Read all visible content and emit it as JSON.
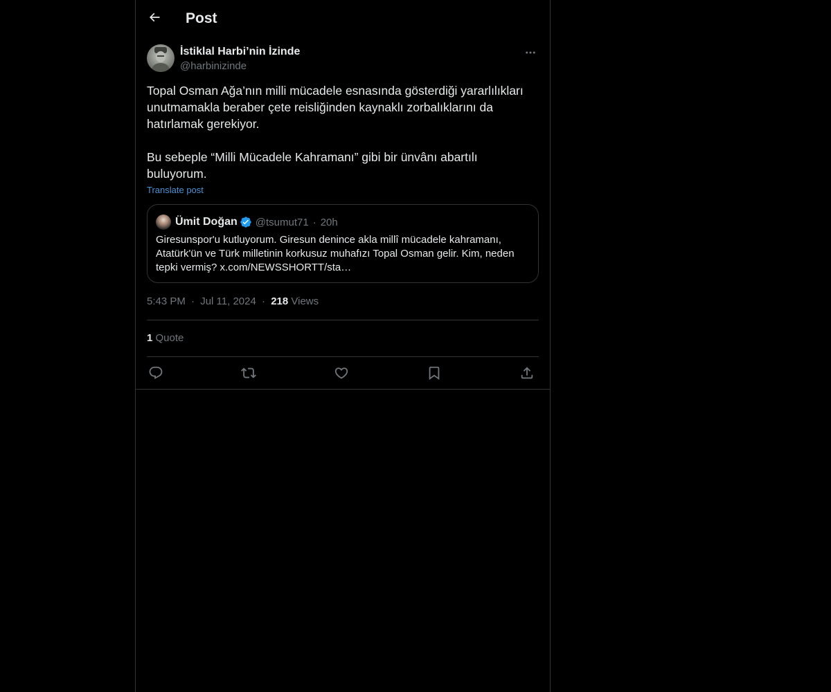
{
  "header": {
    "title": "Post",
    "back_icon": "arrow-left-icon"
  },
  "post": {
    "author_name": "İstiklal Harbi’nin İzinde",
    "author_handle": "@harbinizinde",
    "paragraph_1": "Topal Osman Ağa’nın milli mücadele esnasında gösterdiği yararlılıkları unutmamakla beraber çete reisliğinden kaynaklı zorbalıklarını da hatırlamak gerekiyor.",
    "paragraph_2": "Bu sebeple “Milli Mücadele Kahramanı” gibi bir ünvânı abartılı buluyorum.",
    "translate_label": "Translate post",
    "time": "5:43 PM",
    "separator": "·",
    "date": "Jul 11, 2024",
    "views_count": "218",
    "views_label": "Views",
    "quotes_count": "1",
    "quotes_label": "Quote"
  },
  "quoted_post": {
    "author_name": "Ümit Doğan",
    "author_handle": "@tsumut71",
    "separator": "·",
    "age": "20h",
    "text": "Giresunspor'u kutluyorum. Giresun denince akla millî mücadele kahramanı, Atatürk'ün ve Türk milletinin korkusuz muhafızı Topal Osman gelir. Kim, neden tepki vermiş? x.com/NEWSSHORTT/sta…",
    "verified_color": "#1d9bf0"
  },
  "actions": [
    {
      "name": "reply-icon"
    },
    {
      "name": "repost-icon"
    },
    {
      "name": "like-icon"
    },
    {
      "name": "bookmark-icon"
    },
    {
      "name": "share-icon"
    }
  ],
  "colors": {
    "background": "#000000",
    "text": "#e7e9ea",
    "secondary_text": "#71767b",
    "border": "#2f3336",
    "link": "#4a92d6"
  }
}
